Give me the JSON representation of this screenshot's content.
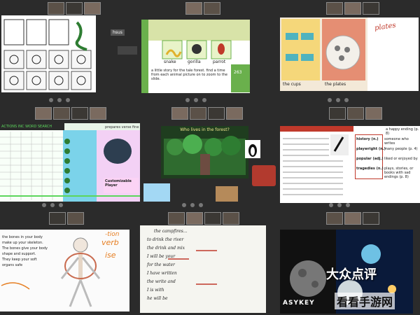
{
  "screen2": {
    "sidebar_label": "hsus",
    "sentence": "a little story for the tale forest. find a time from each animal picture on to zoom to the slide.",
    "animals": [
      "snake",
      "gorilla",
      "parrot"
    ],
    "score": "263"
  },
  "screen3": {
    "handwritten": "plates",
    "captions": [
      "the cups",
      "the plates"
    ]
  },
  "screen4": {
    "title": "ACTIONS INC WORD SEARCH",
    "note": "Customizable Player",
    "header": "prepares verse fine"
  },
  "screen5": {
    "title": "Who lives in the forest?"
  },
  "screen6": {
    "top_text": "a happy ending (p. 8)",
    "terms": [
      {
        "term": "history (n.)",
        "def": "someone who writes"
      },
      {
        "term": "playwright (n.)",
        "def": "many people (p. 4)"
      },
      {
        "term": "popular (adj.)",
        "def": "liked or enjoyed by"
      },
      {
        "term": "tragedies (n.)",
        "def": "plays, stories, or books with sad endings (p. 8)"
      }
    ]
  },
  "screen7": {
    "lines": [
      "the bones in your body",
      "make up your skeleton.",
      "The bones give your body",
      "shape and support.",
      "They keep your soft",
      "organs safe"
    ],
    "red_notes": [
      "verb",
      "ise",
      "-tion"
    ]
  },
  "screen8": {
    "lines": [
      "the campfires...",
      "to drink the river",
      "the drink and mix",
      "I will be your",
      "for the water",
      "I have written",
      "the write and",
      "I is with",
      "he will be"
    ]
  },
  "screen9": {
    "title": "ASYKEY"
  },
  "watermarks": {
    "dianping": "大众点评",
    "site": "看看手游网"
  }
}
